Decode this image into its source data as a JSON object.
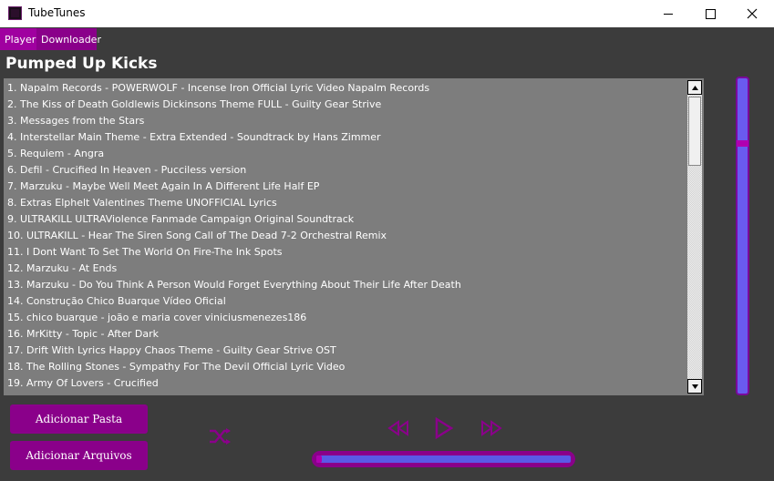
{
  "window": {
    "title": "TubeTunes"
  },
  "tabs": [
    {
      "label": "Player"
    },
    {
      "label": "Downloader"
    }
  ],
  "now_playing": {
    "title": "Pumped Up Kicks"
  },
  "playlist": [
    "1. Napalm Records - POWERWOLF - Incense  Iron Official Lyric Video  Napalm Records",
    "2. The Kiss of Death Goldlewis Dickinsons Theme FULL - Guilty Gear Strive",
    "3. Messages from the Stars",
    "4. Interstellar Main Theme - Extra Extended - Soundtrack by  Hans Zimmer",
    "5. Requiem - Angra",
    "6. Dєfil - Crucified In Heaven - Pucciless version",
    "7. Marzuku - Maybe Well Meet Again In A Different Life Half EP",
    "8. Extras Elphelt Valentines Theme UNOFFICIAL Lyrics",
    "9. ULTRAKILL ULTRAViolence Fanmade Campaign Original Soundtrack",
    "10. ULTRAKILL - Hear The Siren Song Call of The Dead 7-2 Orchestral Remix",
    "11. I Dont Want To Set The World On Fire-The Ink Spots",
    "12. Marzuku - At Ends",
    "13. Marzuku - Do You Think A Person Would Forget Everything About Their Life After Death",
    "14. Construção  Chico Buarque Vídeo Oficial",
    "15. chico buarque - joão e maria cover viniciusmenezes186",
    "16. MrKitty - Topic - After Dark",
    "17. Drift With Lyrics Happy Chaos Theme - Guilty Gear Strive OST",
    "18. The Rolling Stones - Sympathy For The Devil Official Lyric Video",
    "19. Army Of Lovers - Crucified"
  ],
  "buttons": {
    "add_folder": "Adicionar Pasta",
    "add_files": "Adicionar Arquivos"
  },
  "controls": {
    "shuffle_icon": "shuffle-icon",
    "prev_icon": "previous-icon",
    "play_icon": "play-icon",
    "next_icon": "next-icon"
  },
  "volume": {
    "level": 0.8
  },
  "progress": {
    "value": 0.02
  },
  "colors": {
    "accent": "#8a008a",
    "slider": "#6a5af0",
    "background": "#3c3c3c",
    "list_bg": "#7d7d7d"
  }
}
